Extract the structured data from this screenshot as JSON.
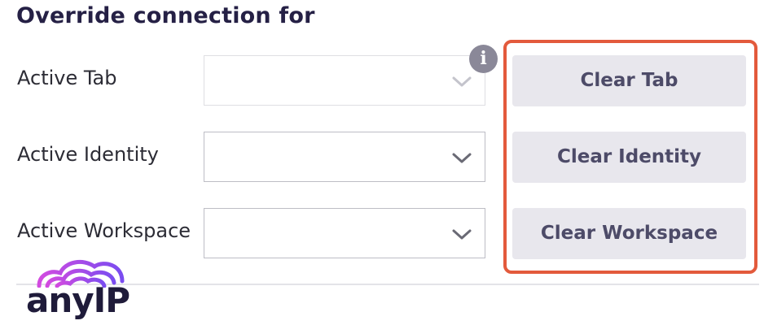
{
  "section": {
    "title": "Override connection for"
  },
  "rows": [
    {
      "label": "Active Tab",
      "value": "",
      "disabled": true,
      "button_label": "Clear Tab"
    },
    {
      "label": "Active Identity",
      "value": "",
      "disabled": false,
      "button_label": "Clear Identity"
    },
    {
      "label": "Active Workspace",
      "value": "",
      "disabled": false,
      "button_label": "Clear Workspace"
    }
  ],
  "info_icon": {
    "glyph": "i",
    "icon": "info-icon"
  },
  "watermark": {
    "text": "anyIP"
  },
  "colors": {
    "title": "#252045",
    "button_bg": "#e8e7ed",
    "button_text": "#4d4b68",
    "highlight": "#e35a3c",
    "info_icon_bg": "#8a8898",
    "logo_gradient_start": "#d24be0",
    "logo_gradient_end": "#7a4cf0"
  }
}
